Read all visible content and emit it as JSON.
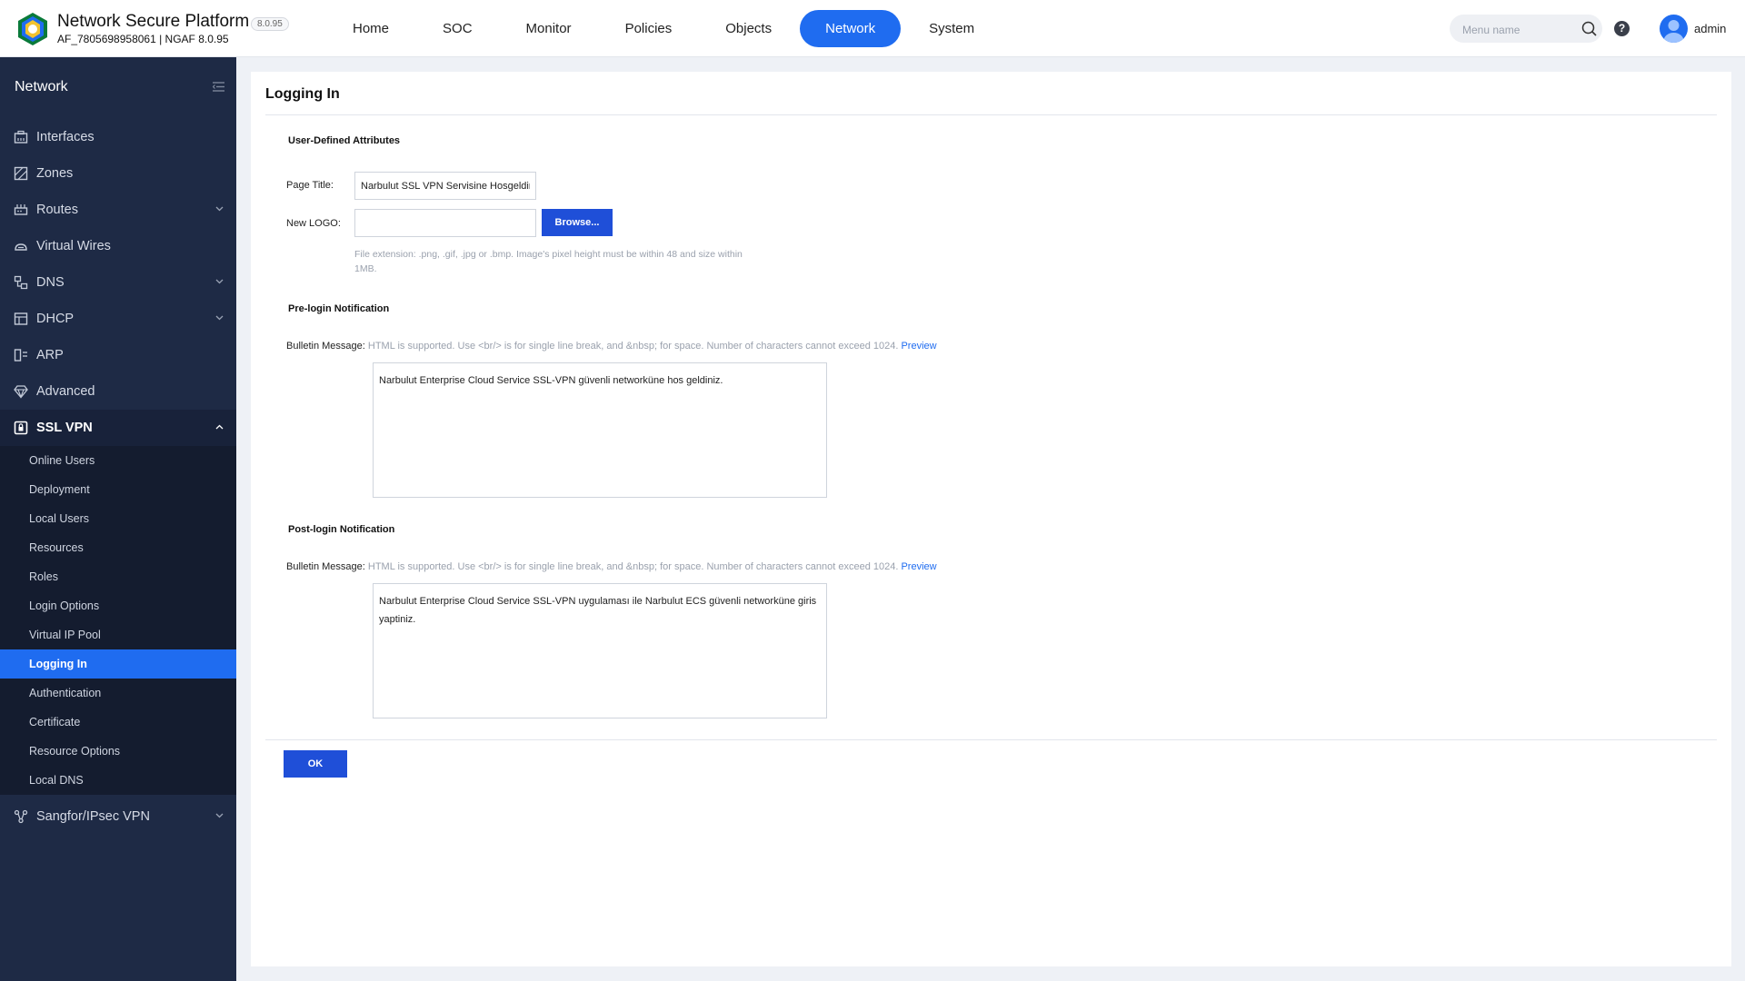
{
  "header": {
    "brand_title": "Network Secure Platform",
    "version_badge": "8.0.95",
    "brand_sub": "AF_7805698958061 | NGAF 8.0.95",
    "nav": [
      {
        "label": "Home"
      },
      {
        "label": "SOC"
      },
      {
        "label": "Monitor"
      },
      {
        "label": "Policies"
      },
      {
        "label": "Objects"
      },
      {
        "label": "Network",
        "active": true
      },
      {
        "label": "System"
      }
    ],
    "search_placeholder": "Menu name",
    "help_label": "?",
    "username": "admin",
    "accent_color": "#1f6cf0"
  },
  "sidebar": {
    "title": "Network",
    "items": [
      {
        "label": "Interfaces",
        "icon": "interfaces-icon"
      },
      {
        "label": "Zones",
        "icon": "zones-icon"
      },
      {
        "label": "Routes",
        "icon": "routes-icon",
        "expandable": true
      },
      {
        "label": "Virtual Wires",
        "icon": "virtual-wires-icon"
      },
      {
        "label": "DNS",
        "icon": "dns-icon",
        "expandable": true
      },
      {
        "label": "DHCP",
        "icon": "dhcp-icon",
        "expandable": true
      },
      {
        "label": "ARP",
        "icon": "arp-icon"
      },
      {
        "label": "Advanced",
        "icon": "advanced-icon"
      },
      {
        "label": "SSL VPN",
        "icon": "ssl-vpn-icon",
        "expanded": true
      },
      {
        "label": "Sangfor/IPsec VPN",
        "icon": "ipsec-vpn-icon",
        "expandable": true
      }
    ],
    "ssl_vpn_children": [
      {
        "label": "Online Users"
      },
      {
        "label": "Deployment"
      },
      {
        "label": "Local Users"
      },
      {
        "label": "Resources"
      },
      {
        "label": "Roles"
      },
      {
        "label": "Login Options"
      },
      {
        "label": "Virtual IP Pool"
      },
      {
        "label": "Logging In",
        "active": true
      },
      {
        "label": "Authentication"
      },
      {
        "label": "Certificate"
      },
      {
        "label": "Resource Options"
      },
      {
        "label": "Local DNS"
      }
    ]
  },
  "page": {
    "title": "Logging In",
    "user_defined": {
      "section_title": "User-Defined Attributes",
      "page_title_label": "Page Title:",
      "page_title_value": "Narbulut SSL VPN Servisine Hosgeldiniz",
      "new_logo_label": "New LOGO:",
      "new_logo_value": "",
      "browse_label": "Browse...",
      "file_hint_line1": "File extension: .png, .gif, .jpg or .bmp. Image's pixel height must be within 48 and size within",
      "file_hint_line2": "1MB."
    },
    "pre_login": {
      "section_title": "Pre-login Notification",
      "bulletin_label": "Bulletin Message:",
      "bulletin_hint": "HTML is supported. Use <br/> is for single line break, and &nbsp; for space. Number of characters cannot exceed 1024.",
      "preview_label": "Preview",
      "message": "Narbulut Enterprise Cloud Service SSL-VPN güvenli networküne hos geldiniz."
    },
    "post_login": {
      "section_title": "Post-login Notification",
      "bulletin_label": "Bulletin Message:",
      "bulletin_hint": "HTML is supported. Use <br/> is for single line break, and &nbsp; for space. Number of characters cannot exceed 1024.",
      "preview_label": "Preview",
      "message": "Narbulut Enterprise Cloud Service SSL-VPN uygulaması ile Narbulut ECS güvenli networküne giris yaptiniz."
    },
    "ok_label": "OK"
  }
}
